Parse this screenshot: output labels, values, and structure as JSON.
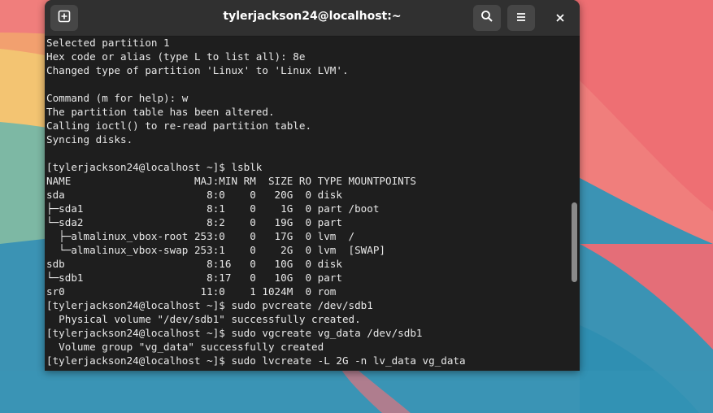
{
  "window": {
    "title": "tylerjackson24@localhost:~"
  },
  "icons": {
    "new_tab": "new-tab-icon",
    "search": "search-icon",
    "menu": "hamburger-menu-icon",
    "close": "close-icon"
  },
  "colors": {
    "terminal_bg": "#1e1e1e",
    "titlebar_bg": "#303030",
    "text": "#e8e8e8"
  },
  "terminal": {
    "lines": [
      "Selected partition 1",
      "Hex code or alias (type L to list all): 8e",
      "Changed type of partition 'Linux' to 'Linux LVM'.",
      "",
      "Command (m for help): w",
      "The partition table has been altered.",
      "Calling ioctl() to re-read partition table.",
      "Syncing disks.",
      "",
      "[tylerjackson24@localhost ~]$ lsblk",
      "NAME                    MAJ:MIN RM  SIZE RO TYPE MOUNTPOINTS",
      "sda                       8:0    0   20G  0 disk",
      "├─sda1                    8:1    0    1G  0 part /boot",
      "└─sda2                    8:2    0   19G  0 part",
      "  ├─almalinux_vbox-root 253:0    0   17G  0 lvm  /",
      "  └─almalinux_vbox-swap 253:1    0    2G  0 lvm  [SWAP]",
      "sdb                       8:16   0   10G  0 disk",
      "└─sdb1                    8:17   0   10G  0 part",
      "sr0                      11:0    1 1024M  0 rom",
      "[tylerjackson24@localhost ~]$ sudo pvcreate /dev/sdb1",
      "  Physical volume \"/dev/sdb1\" successfully created.",
      "[tylerjackson24@localhost ~]$ sudo vgcreate vg_data /dev/sdb1",
      "  Volume group \"vg_data\" successfully created",
      "[tylerjackson24@localhost ~]$ sudo lvcreate -L 2G -n lv_data vg_data"
    ]
  }
}
